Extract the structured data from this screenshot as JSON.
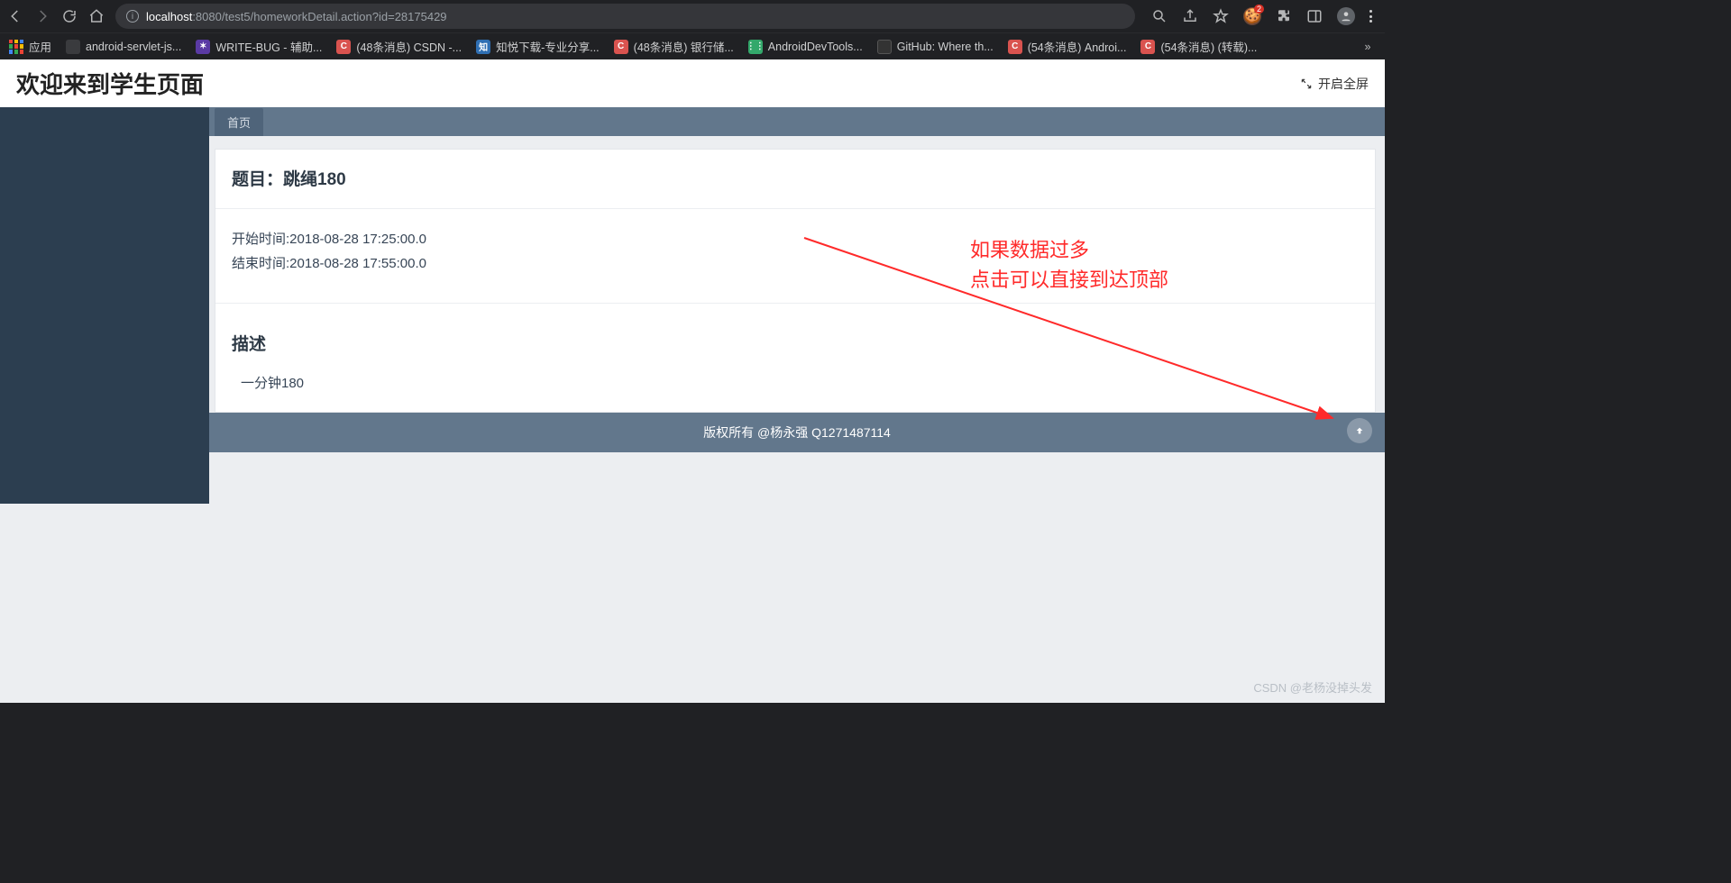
{
  "browser": {
    "url_host": "localhost",
    "url_port_path": ":8080/test5/homeworkDetail.action?id=28175429",
    "apps_label": "应用",
    "overflow_glyph": "»"
  },
  "bookmarks": [
    {
      "label": "android-servlet-js...",
      "fav": "doc",
      "glyph": ""
    },
    {
      "label": "WRITE-BUG - 辅助...",
      "fav": "bug",
      "glyph": "✶"
    },
    {
      "label": "(48条消息) CSDN -...",
      "fav": "c",
      "glyph": "C"
    },
    {
      "label": "知悦下载-专业分享...",
      "fav": "zy",
      "glyph": "知"
    },
    {
      "label": "(48条消息) 银行储...",
      "fav": "c",
      "glyph": "C"
    },
    {
      "label": "AndroidDevTools...",
      "fav": "adt",
      "glyph": "⋮⋮"
    },
    {
      "label": "GitHub: Where th...",
      "fav": "gh",
      "glyph": ""
    },
    {
      "label": "(54条消息) Androi...",
      "fav": "c",
      "glyph": "C"
    },
    {
      "label": "(54条消息) (转载)...",
      "fav": "c",
      "glyph": "C"
    }
  ],
  "header": {
    "title": "欢迎来到学生页面",
    "fullscreen": "开启全屏"
  },
  "tabs": {
    "home": "首页"
  },
  "homework": {
    "title_label": "题目：",
    "title_value": "跳绳180",
    "start_label": "开始时间:",
    "start_value": "2018-08-28 17:25:00.0",
    "end_label": "结束时间:",
    "end_value": "2018-08-28 17:55:00.0",
    "desc_heading": "描述",
    "desc_text": "一分钟180"
  },
  "footer": {
    "copyright": "版权所有 @杨永强 Q1271487114"
  },
  "annotation": {
    "line1": "如果数据过多",
    "line2": "点击可以直接到达顶部"
  },
  "watermark": "CSDN @老杨没掉头发"
}
